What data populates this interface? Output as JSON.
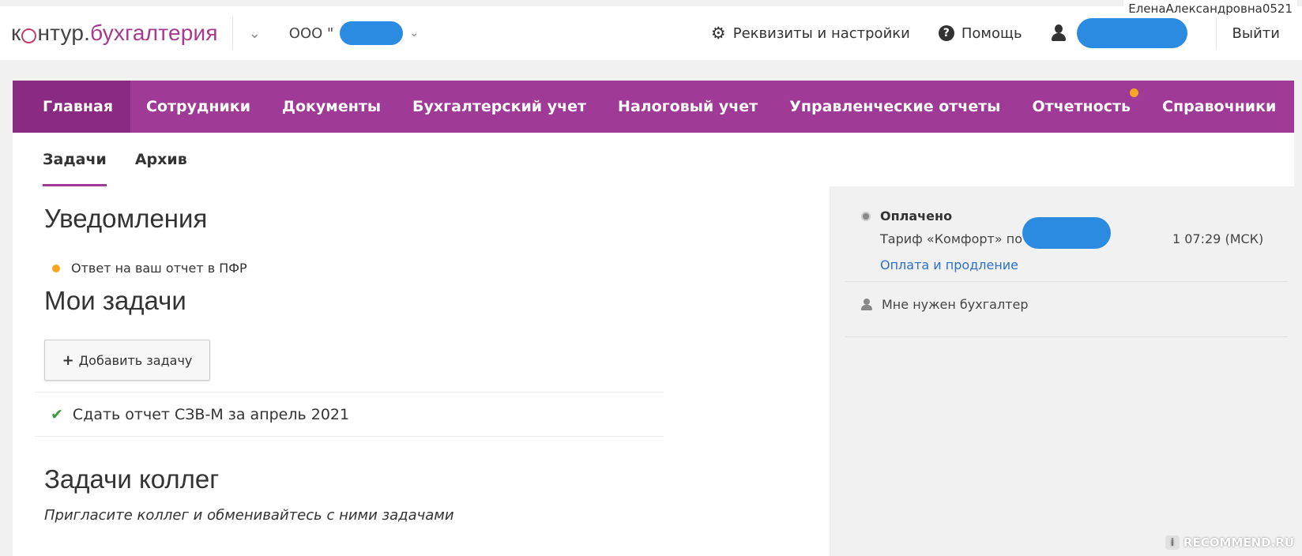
{
  "watermark_top": "ЕленаАлександровна0521",
  "header": {
    "logo": {
      "k": "к",
      "ntur": "нтур",
      "dot": ".",
      "buh": "бухгалтерия"
    },
    "org_label": "ООО \"",
    "settings_label": "Реквизиты и настройки",
    "help_label": "Помощь",
    "logout_label": "Выйти"
  },
  "mainnav": {
    "items": [
      {
        "label": "Главная"
      },
      {
        "label": "Сотрудники"
      },
      {
        "label": "Документы"
      },
      {
        "label": "Бухгалтерский учет"
      },
      {
        "label": "Налоговый учет"
      },
      {
        "label": "Управленческие отчеты"
      },
      {
        "label": "Отчетность"
      },
      {
        "label": "Справочники"
      }
    ]
  },
  "subnav": {
    "items": [
      {
        "label": "Задачи"
      },
      {
        "label": "Архив"
      }
    ]
  },
  "main": {
    "notifications_title": "Уведомления",
    "notification_text": "Ответ на ваш отчет в ПФР",
    "my_tasks_title": "Мои задачи",
    "add_task_label": "Добавить задачу",
    "task_text": "Сдать отчет СЗВ-М за апрель 2021",
    "colleagues_title": "Задачи коллег",
    "invite_text": "Пригласите коллег и обменивайтесь с ними задачами"
  },
  "sidebar": {
    "paid_title": "Оплачено",
    "tariff_text": "Тариф «Комфорт» по",
    "tariff_tail": "1 07:29 (МСК)",
    "pay_link": "Оплата и продление",
    "need_accountant": "Мне нужен бухгалтер"
  },
  "footer": {
    "recommend": "RECOMMEND.RU"
  }
}
